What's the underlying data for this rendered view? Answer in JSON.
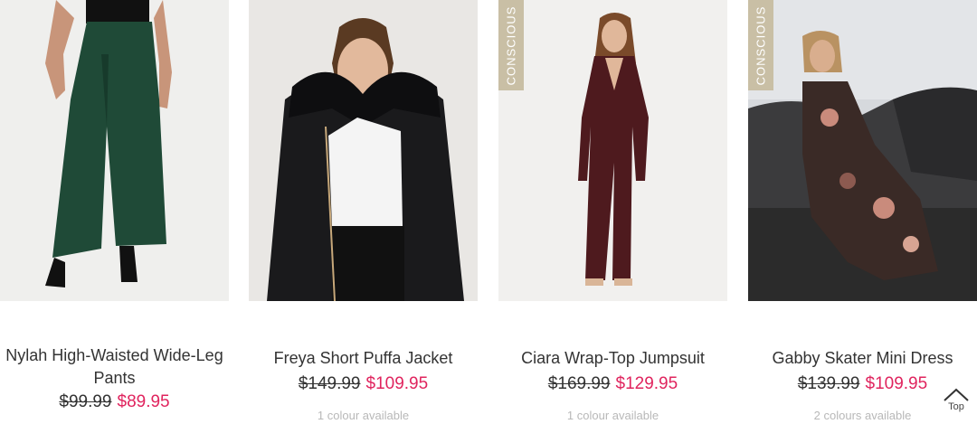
{
  "products": [
    {
      "name": "Nylah High-Waisted Wide-Leg Pants",
      "was_price": "$99.99",
      "now_price": "$89.95",
      "colours": "",
      "badge": ""
    },
    {
      "name": "Freya Short Puffa Jacket",
      "was_price": "$149.99",
      "now_price": "$109.95",
      "colours": "1 colour available",
      "badge": ""
    },
    {
      "name": "Ciara Wrap-Top Jumpsuit",
      "was_price": "$169.99",
      "now_price": "$129.95",
      "colours": "1 colour available",
      "badge": "CONSCIOUS"
    },
    {
      "name": "Gabby Skater Mini Dress",
      "was_price": "$139.99",
      "now_price": "$109.95",
      "colours": "2 colours available",
      "badge": "CONSCIOUS"
    }
  ],
  "back_to_top": {
    "label": "Top",
    "icon": "chevron-up-icon"
  },
  "colors": {
    "sale_price": "#e0245e",
    "badge_bg": "#c9bfa5",
    "text": "#333333",
    "muted": "#b8b8b8"
  }
}
